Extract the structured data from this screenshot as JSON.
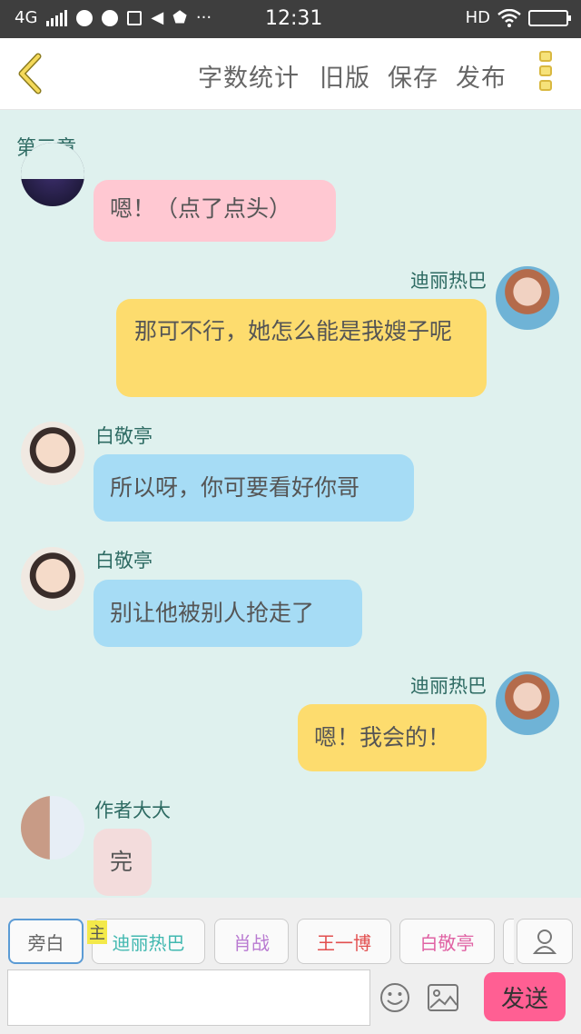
{
  "status_bar": {
    "network": "4G",
    "time": "12:31",
    "hd": "HD"
  },
  "toolbar": {
    "word_count": "字数统计",
    "old_version": "旧版",
    "save": "保存",
    "publish": "发布"
  },
  "chapter_title": "第三章",
  "messages": [
    {
      "side": "left",
      "name": "",
      "text": "嗯！（点了点头）",
      "bubble_color": "#ffc8d2",
      "avatar": "dark"
    },
    {
      "side": "right",
      "name": "迪丽热巴",
      "text": "那可不行，她怎么能是我嫂子呢",
      "bubble_color": "#fddc6e",
      "avatar": "dilireba"
    },
    {
      "side": "left",
      "name": "白敬亭",
      "text": "所以呀，你可要看好你哥",
      "bubble_color": "#a6dcf5",
      "avatar": "baijingting"
    },
    {
      "side": "left",
      "name": "白敬亭",
      "text": "别让他被别人抢走了",
      "bubble_color": "#a6dcf5",
      "avatar": "baijingting"
    },
    {
      "side": "right",
      "name": "迪丽热巴",
      "text": "嗯！我会的！",
      "bubble_color": "#fddc6e",
      "avatar": "dilireba"
    },
    {
      "side": "left",
      "name": "作者大大",
      "text": "完",
      "bubble_color": "#f3dcdc",
      "avatar": "author"
    }
  ],
  "roles": [
    {
      "label": "旁白",
      "color": "#666666",
      "selected": true
    },
    {
      "label": "迪丽热巴",
      "color": "#41b8b0",
      "selected": false
    },
    {
      "label": "肖战",
      "color": "#b97ad1",
      "selected": false
    },
    {
      "label": "王一博",
      "color": "#e24f4f",
      "selected": false
    },
    {
      "label": "白敬亭",
      "color": "#e063a4",
      "selected": false
    }
  ],
  "main_badge": "主",
  "input": {
    "value": "",
    "placeholder": ""
  },
  "send_label": "发送",
  "icons": {
    "back": "chevron-left-icon",
    "more": "more-vertical-icon",
    "emoji": "emoji-icon",
    "image": "image-icon",
    "person": "person-icon"
  }
}
